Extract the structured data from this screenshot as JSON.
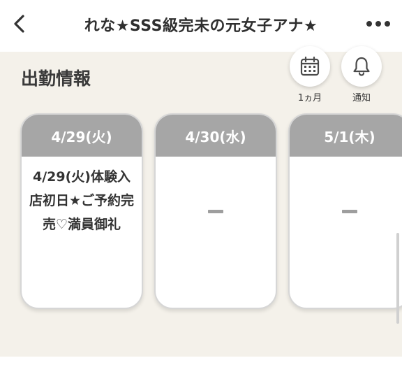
{
  "header": {
    "title": "れな★SSS級完未の元女子アナ★",
    "back_icon": "chevron-left-icon",
    "more_icon": "more-horizontal-icon"
  },
  "section": {
    "title": "出勤情報"
  },
  "actions": [
    {
      "label": "1ヵ月",
      "icon": "calendar-icon"
    },
    {
      "label": "通知",
      "icon": "bell-icon"
    }
  ],
  "schedule": [
    {
      "date": "4/29(火)",
      "note": "4/29(火)体験入店初日★ご予約完売♡満員御礼"
    },
    {
      "date": "4/30(水)",
      "note": "-"
    },
    {
      "date": "5/1(木)",
      "note": "-"
    }
  ],
  "colors": {
    "card_header": "#a6a6a6",
    "background": "#f4f1ea"
  }
}
